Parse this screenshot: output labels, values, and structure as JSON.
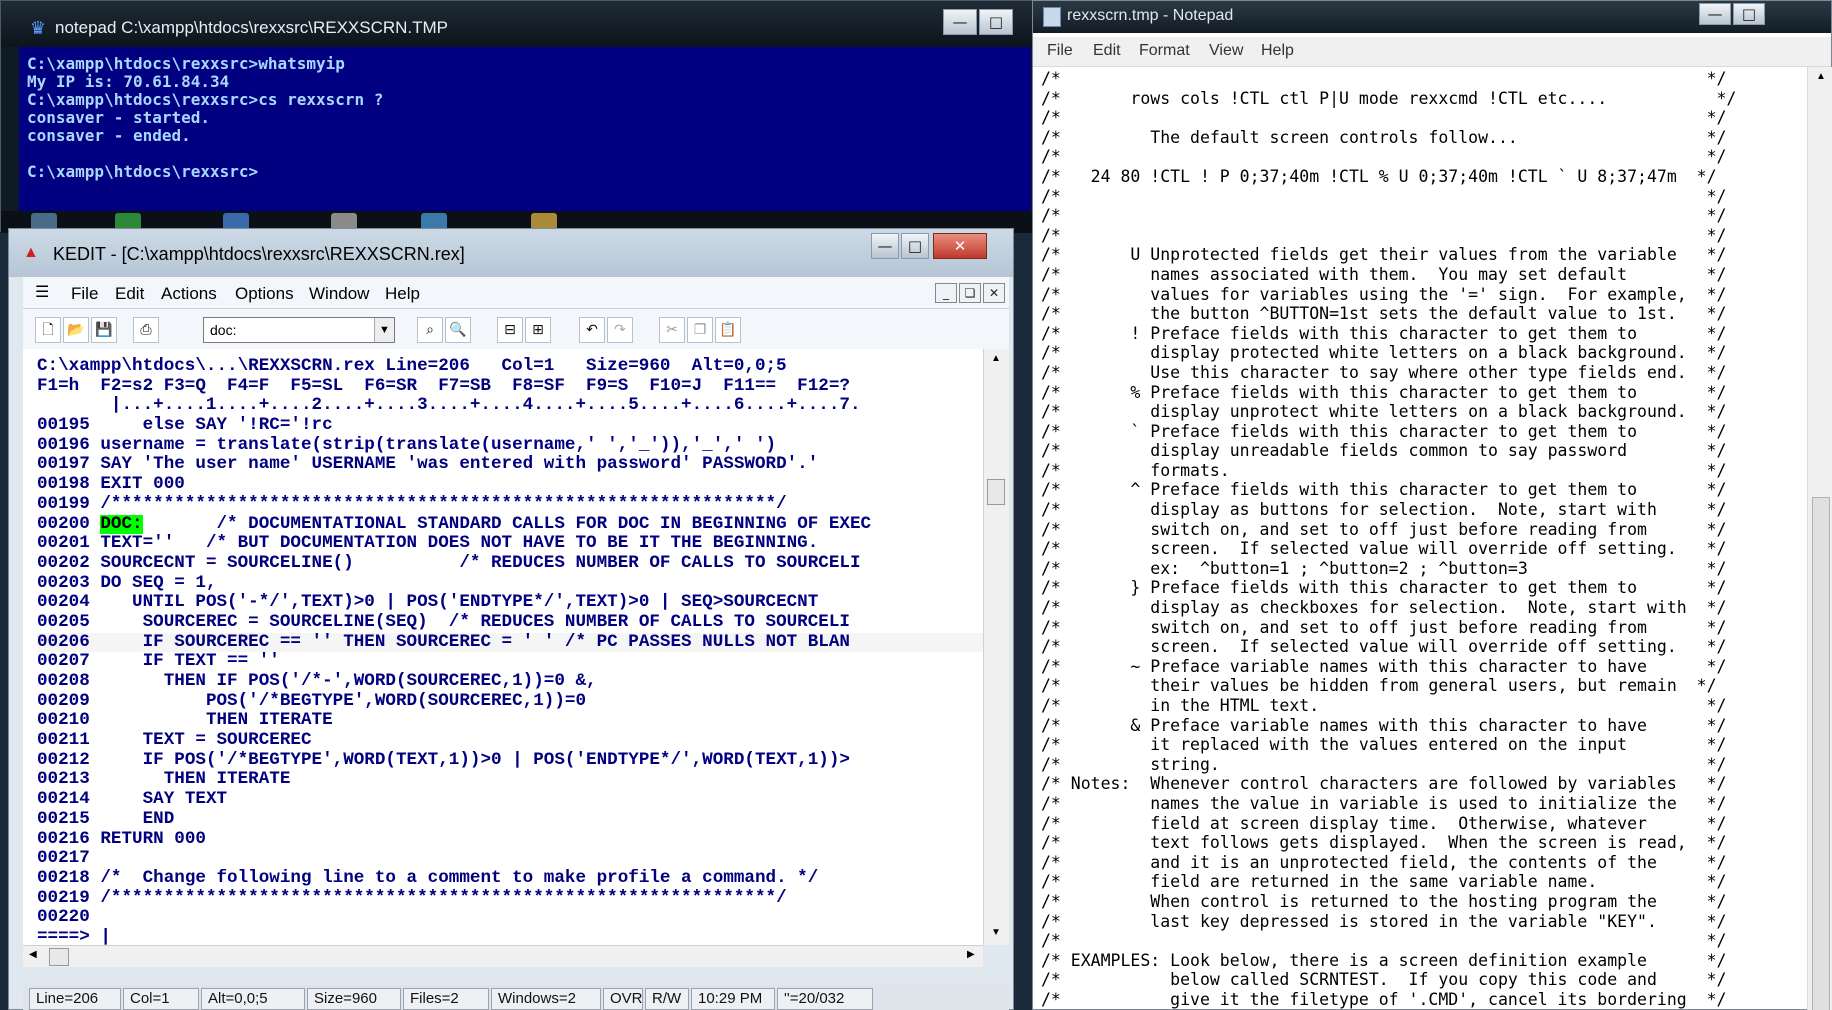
{
  "console": {
    "title": "notepad C:\\xampp\\htdocs\\rexxsrc\\REXXSCRN.TMP",
    "lines": [
      "C:\\xampp\\htdocs\\rexxsrc>whatsmyip",
      "My IP is: 70.61.84.34",
      "C:\\xampp\\htdocs\\rexxsrc>cs rexxscrn ?",
      "consaver - started.",
      "consaver - ended.",
      "",
      "C:\\xampp\\htdocs\\rexxsrc>"
    ]
  },
  "kedit": {
    "title": "KEDIT - [C:\\xampp\\htdocs\\rexxsrc\\REXXSCRN.rex]",
    "menu": [
      "File",
      "Edit",
      "Actions",
      "Options",
      "Window",
      "Help"
    ],
    "combo_value": "doc:",
    "info_line": "C:\\xampp\\htdocs\\...\\REXXSCRN.rex Line=206   Col=1   Size=960  Alt=0,0;5",
    "fkeys_line": "F1=h  F2=s2 F3=Q  F4=F  F5=SL  F6=SR  F7=SB  F8=SF  F9=S  F10=J  F11==  F12=?",
    "scale_line": "       |...+....1....+....2....+....3....+....4....+....5....+....6....+....7.",
    "lines": [
      {
        "n": "00195",
        "t": "    else SAY '!RC='!rc"
      },
      {
        "n": "00196",
        "t": "username = translate(strip(translate(username,' ','_')),'_',' ')"
      },
      {
        "n": "00197",
        "t": "SAY 'The user name' USERNAME 'was entered with password' PASSWORD'.'"
      },
      {
        "n": "00198",
        "t": "EXIT 000"
      },
      {
        "n": "00199",
        "t": "/***************************************************************/"
      },
      {
        "n": "00200",
        "t": "DOC:",
        "rest": "       /* DOCUMENTATIONAL STANDARD CALLS FOR DOC IN BEGINNING OF EXEC"
      },
      {
        "n": "00201",
        "t": "TEXT=''   /* BUT DOCUMENTATION DOES NOT HAVE TO BE IT THE BEGINNING."
      },
      {
        "n": "00202",
        "t": "SOURCECNT = SOURCELINE()          /* REDUCES NUMBER OF CALLS TO SOURCELI"
      },
      {
        "n": "00203",
        "t": "DO SEQ = 1,"
      },
      {
        "n": "00204",
        "t": "   UNTIL POS('-*/',TEXT)>0 | POS('ENDTYPE*/',TEXT)>0 | SEQ>SOURCECNT"
      },
      {
        "n": "00205",
        "t": "    SOURCEREC = SOURCELINE(SEQ)  /* REDUCES NUMBER OF CALLS TO SOURCELI"
      },
      {
        "n": "00206",
        "t": "    IF SOURCEREC == '' THEN SOURCEREC = ' ' /* PC PASSES NULLS NOT BLAN"
      },
      {
        "n": "00207",
        "t": "    IF TEXT == ''"
      },
      {
        "n": "00208",
        "t": "      THEN IF POS('/*-',WORD(SOURCEREC,1))=0 &,"
      },
      {
        "n": "00209",
        "t": "          POS('/*BEGTYPE',WORD(SOURCEREC,1))=0"
      },
      {
        "n": "00210",
        "t": "          THEN ITERATE"
      },
      {
        "n": "00211",
        "t": "    TEXT = SOURCEREC"
      },
      {
        "n": "00212",
        "t": "    IF POS('/*BEGTYPE',WORD(TEXT,1))>0 | POS('ENDTYPE*/',WORD(TEXT,1))>"
      },
      {
        "n": "00213",
        "t": "      THEN ITERATE"
      },
      {
        "n": "00214",
        "t": "    SAY TEXT"
      },
      {
        "n": "00215",
        "t": "    END"
      },
      {
        "n": "00216",
        "t": "RETURN 000"
      },
      {
        "n": "00217",
        "t": ""
      },
      {
        "n": "00218",
        "t": "/*  Change following line to a comment to make profile a command. */"
      },
      {
        "n": "00219",
        "t": "/***************************************************************/"
      },
      {
        "n": "00220",
        "t": ""
      }
    ],
    "command_prompt": "====> |",
    "status": [
      "Line=206",
      "Col=1",
      "Alt=0,0;5",
      "Size=960",
      "Files=2",
      "Windows=2",
      "OVR",
      "R/W",
      "10:29 PM",
      "''=20/032"
    ]
  },
  "notepad": {
    "title": "rexxscrn.tmp - Notepad",
    "menu": [
      "File",
      "Edit",
      "Format",
      "View",
      "Help"
    ],
    "lines": [
      "/*                                                                 */",
      "/*       rows cols !CTL ctl P|U mode rexxcmd !CTL etc....           */",
      "/*                                                                 */",
      "/*         The default screen controls follow...                   */",
      "/*                                                                 */",
      "/*   24 80 !CTL ! P 0;37;40m !CTL % U 0;37;40m !CTL ` U 8;37;47m  */",
      "/*                                                                 */",
      "/*                                                                 */",
      "/*                                                                 */",
      "/*       U Unprotected fields get their values from the variable   */",
      "/*         names associated with them.  You may set default        */",
      "/*         values for variables using the '=' sign.  For example,  */",
      "/*         the button ^BUTTON=1st sets the default value to 1st.   */",
      "/*       ! Preface fields with this character to get them to       */",
      "/*         display protected white letters on a black background.  */",
      "/*         Use this character to say where other type fields end.  */",
      "/*       % Preface fields with this character to get them to       */",
      "/*         display unprotect white letters on a black background.  */",
      "/*       ` Preface fields with this character to get them to       */",
      "/*         display unreadable fields common to say password        */",
      "/*         formats.                                                */",
      "/*       ^ Preface fields with this character to get them to       */",
      "/*         display as buttons for selection.  Note, start with     */",
      "/*         switch on, and set to off just before reading from      */",
      "/*         screen.  If selected value will override off setting.   */",
      "/*         ex:  ^button=1 ; ^button=2 ; ^button=3                  */",
      "/*       } Preface fields with this character to get them to       */",
      "/*         display as checkboxes for selection.  Note, start with  */",
      "/*         switch on, and set to off just before reading from      */",
      "/*         screen.  If selected value will override off setting.   */",
      "/*       ~ Preface variable names with this character to have      */",
      "/*         their values be hidden from general users, but remain  */",
      "/*         in the HTML text.                                       */",
      "/*       & Preface variable names with this character to have      */",
      "/*         it replaced with the values entered on the input        */",
      "/*         string.                                                 */",
      "/* Notes:  Whenever control characters are followed by variables   */",
      "/*         names the value in variable is used to initialize the   */",
      "/*         field at screen display time.  Otherwise, whatever      */",
      "/*         text follows gets displayed.  When the screen is read,  */",
      "/*         and it is an unprotected field, the contents of the     */",
      "/*         field are returned in the same variable name.           */",
      "/*         When control is returned to the hosting program the     */",
      "/*         last key depressed is stored in the variable \"KEY\".     */",
      "/*                                                                 */",
      "/* EXAMPLES: Look below, there is a screen definition example      */",
      "/*           below called SCRNTEST.  If you copy this code and     */",
      "/*           give it the filetype of '.CMD', cancel its bordering  */"
    ]
  }
}
